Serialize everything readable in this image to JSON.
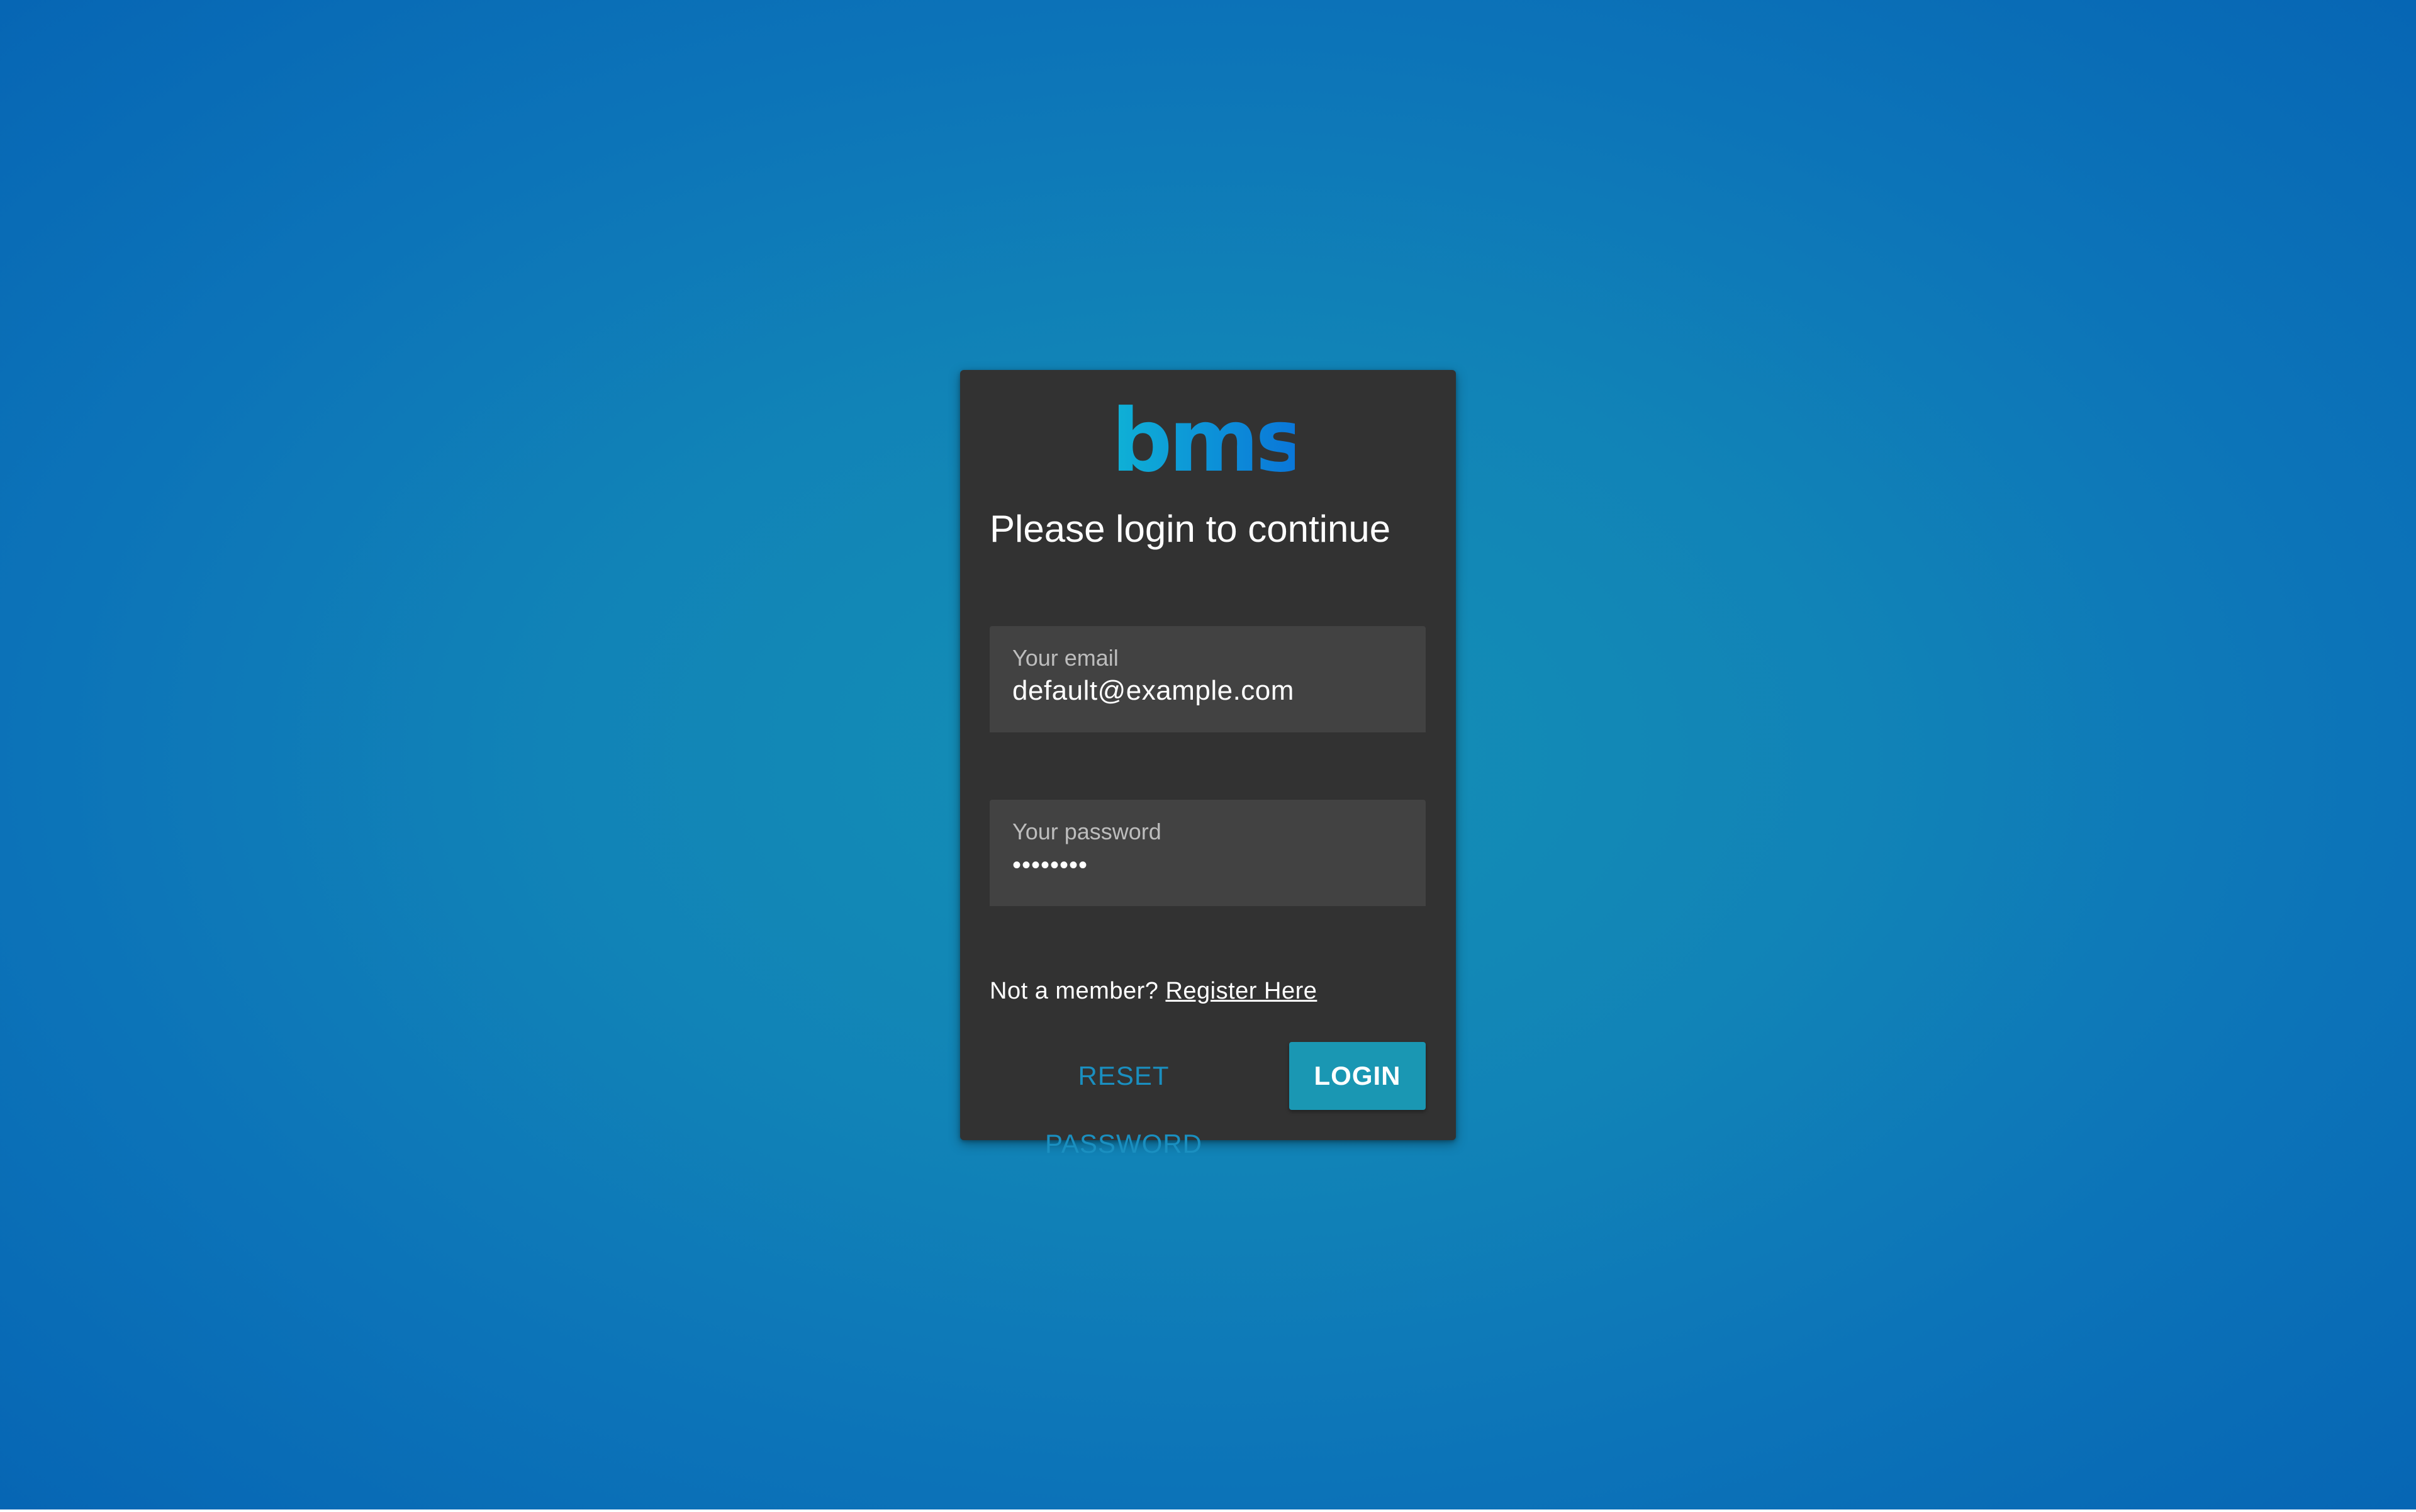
{
  "logo": {
    "text": "bms",
    "gradient_start": "#0fb2d6",
    "gradient_end": "#0a74d9"
  },
  "login_card": {
    "title": "Please login to continue",
    "email": {
      "label": "Your email",
      "value": "default@example.com"
    },
    "password": {
      "label": "Your password",
      "value": "••••••••"
    },
    "register": {
      "prompt": "Not a member?",
      "link_label": "Register Here"
    },
    "buttons": {
      "reset_label": "RESET PASSWORD",
      "login_label": "LOGIN"
    }
  },
  "colors": {
    "card_background": "#323232",
    "field_background": "#424242",
    "accent": "#1a97b3",
    "text_link": "#1a8fc0"
  }
}
